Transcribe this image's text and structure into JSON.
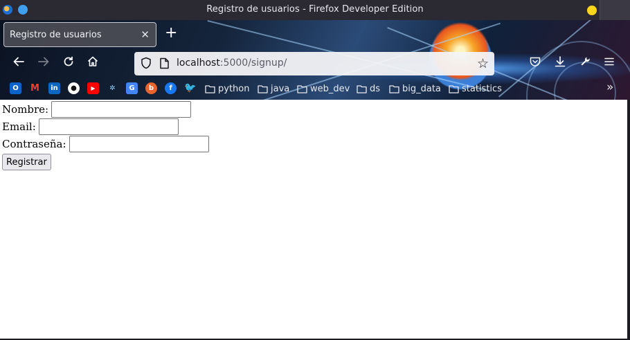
{
  "window": {
    "title": "Registro de usuarios - Firefox Developer Edition",
    "colors": {
      "titlebar": "#2b2a33",
      "wm_blue": "#3ea0ef",
      "wm_yellow": "#f9d51b"
    }
  },
  "tabs": [
    {
      "label": "Registro de usuarios",
      "active": true
    }
  ],
  "toolbar": {
    "back_icon": "arrow-left-icon",
    "forward_icon": "arrow-right-icon",
    "reload_icon": "reload-icon",
    "home_icon": "home-icon",
    "new_tab_glyph": "+",
    "pocket_icon": "pocket-icon",
    "downloads_icon": "download-icon",
    "devtools_icon": "wrench-icon",
    "menu_icon": "hamburger-menu-icon"
  },
  "urlbar": {
    "host": "localhost",
    "path": ":5000/signup/"
  },
  "bookmarks": {
    "icons": [
      "outlook-icon",
      "gmail-icon",
      "linkedin-icon",
      "github-icon",
      "youtube-icon",
      "kaggle-icon",
      "google-translate-icon",
      "bitbucket-icon",
      "facebook-icon",
      "twitter-icon"
    ],
    "folders": [
      "python",
      "java",
      "web_dev",
      "ds",
      "big_data",
      "statistics"
    ],
    "overflow_glyph": "»"
  },
  "form": {
    "nombre_label": "Nombre:",
    "nombre_value": "",
    "email_label": "Email:",
    "email_value": "",
    "password_label": "Contraseña:",
    "password_value": "",
    "submit_label": "Registrar"
  }
}
